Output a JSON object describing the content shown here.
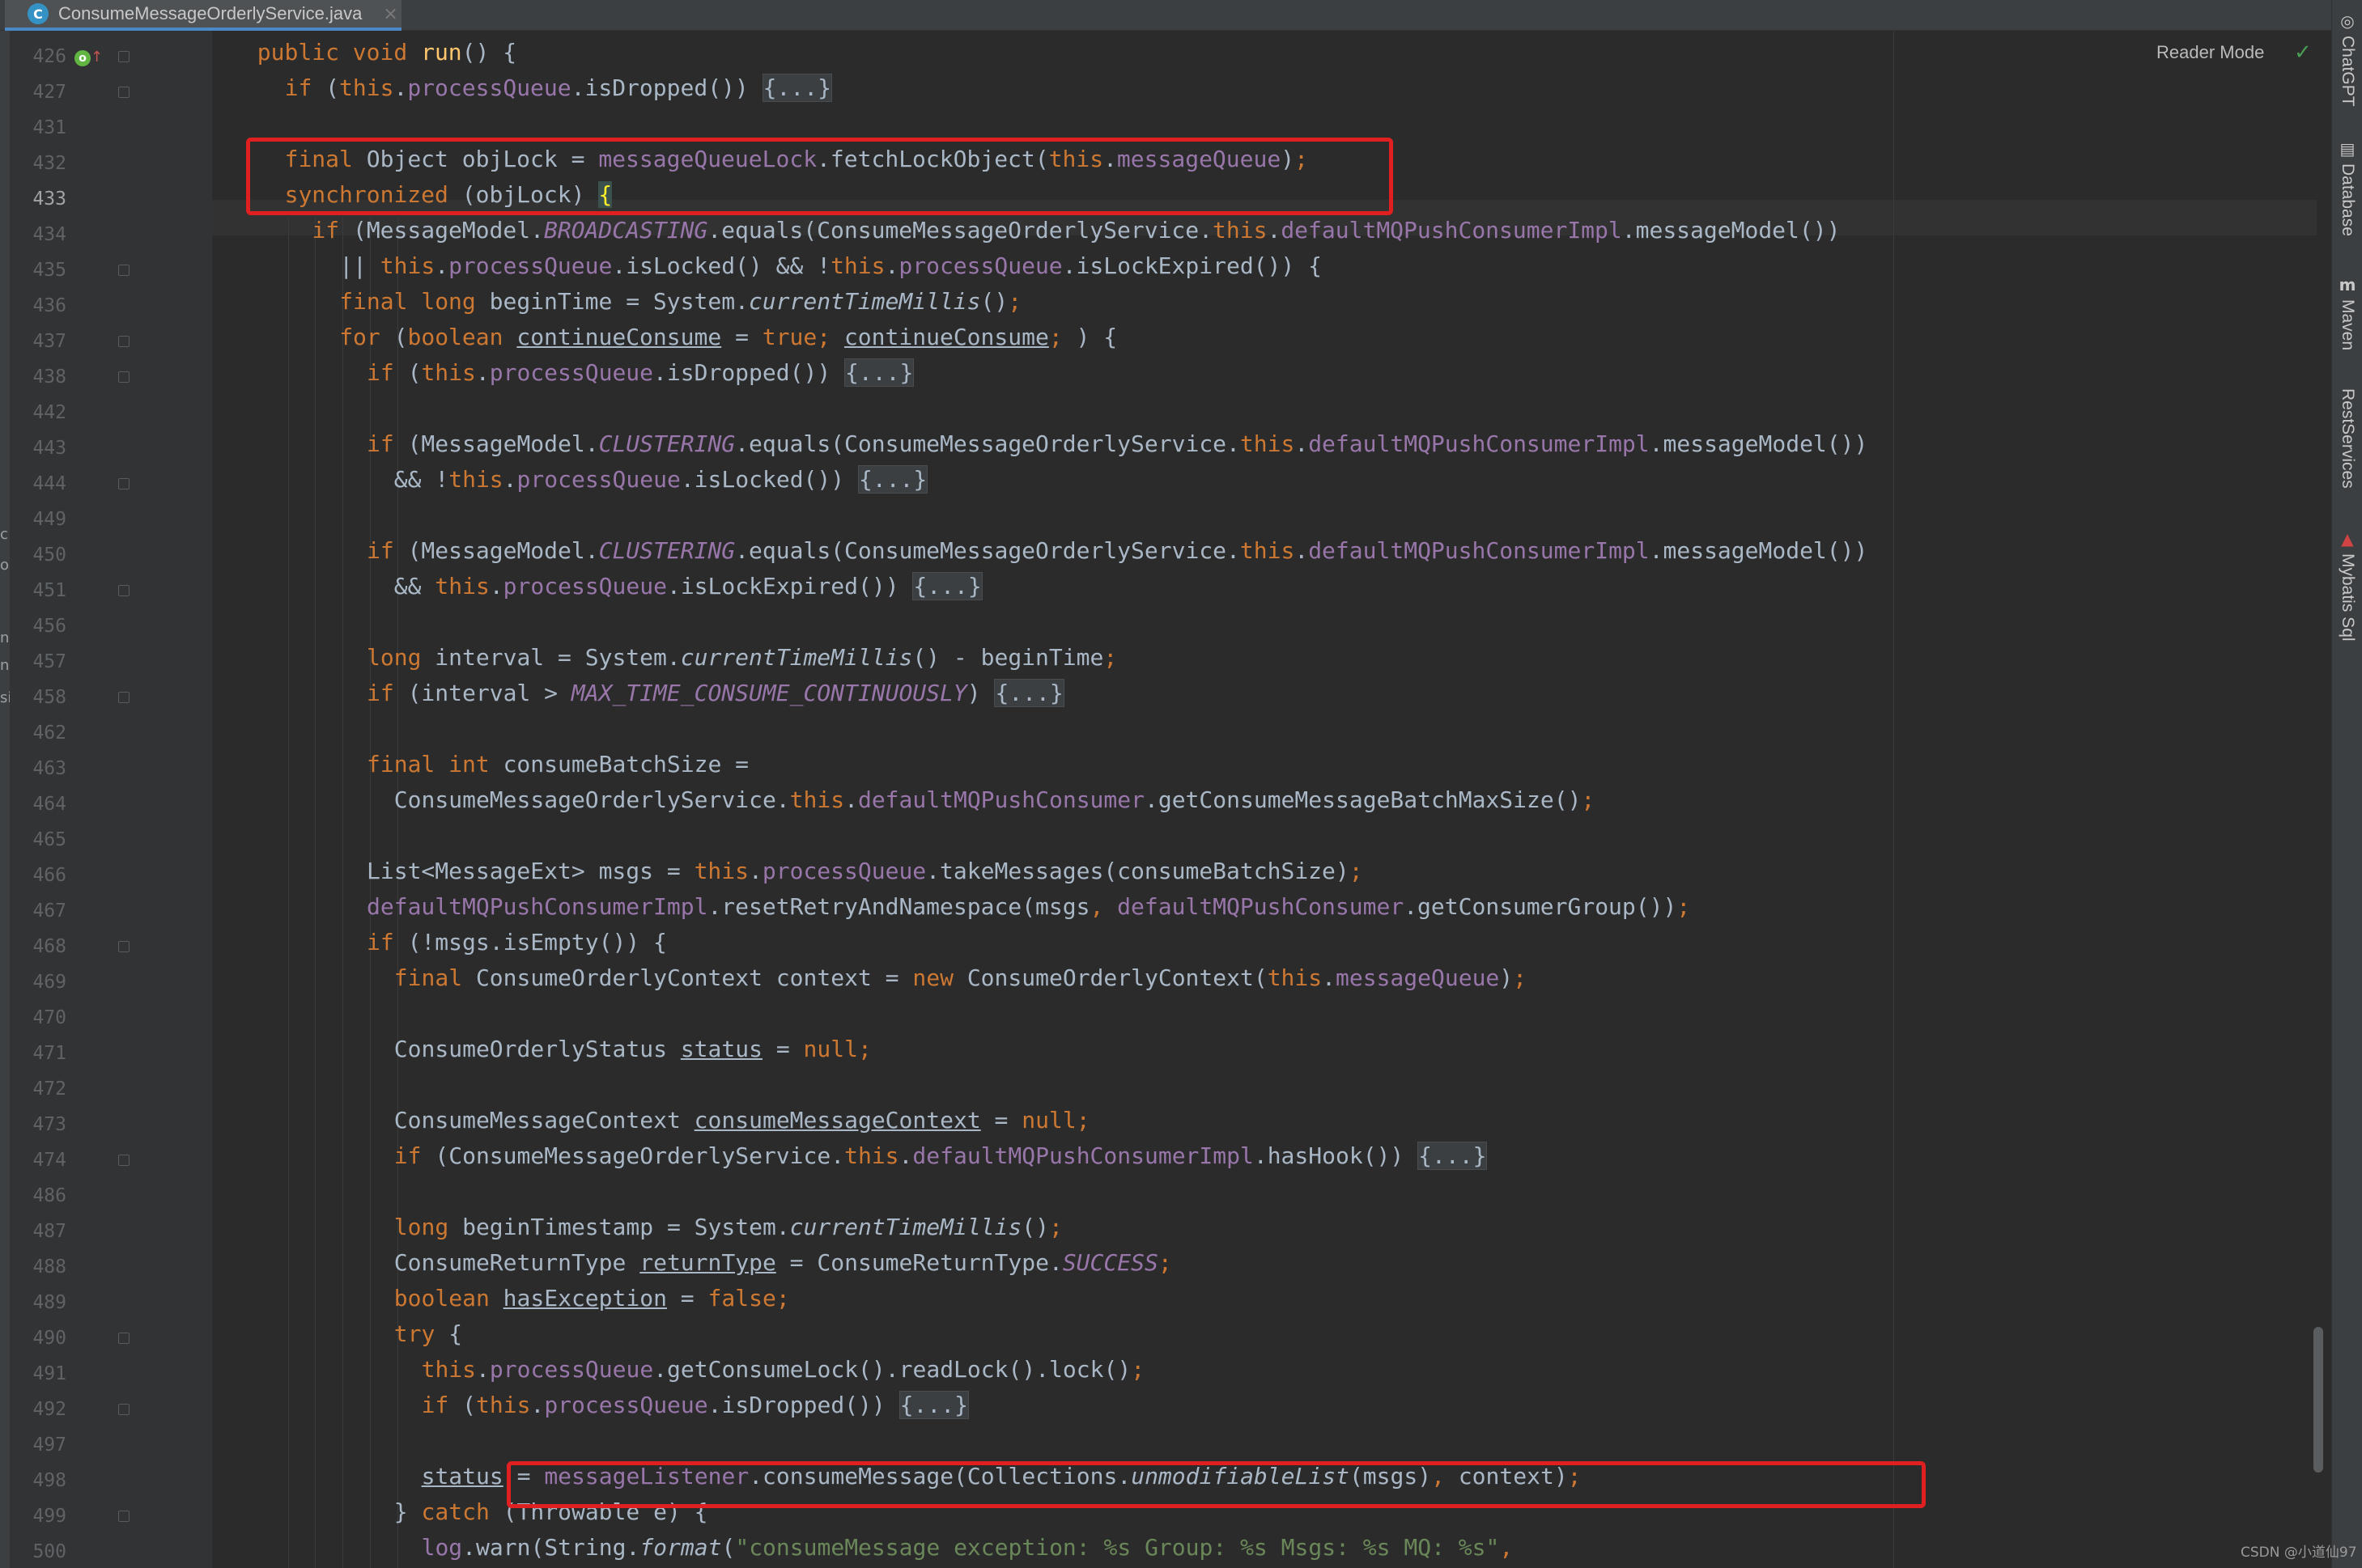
{
  "tab": {
    "icon": "C",
    "filename": "ConsumeMessageOrderlyService.java",
    "close": "×"
  },
  "editor": {
    "reader_mode": "Reader Mode",
    "check_icon": "✓"
  },
  "gutter": {
    "current_line": "433",
    "line_numbers": [
      "426",
      "427",
      "431",
      "432",
      "433",
      "434",
      "435",
      "436",
      "437",
      "438",
      "442",
      "443",
      "444",
      "449",
      "450",
      "451",
      "456",
      "457",
      "458",
      "462",
      "463",
      "464",
      "465",
      "466",
      "467",
      "468",
      "469",
      "470",
      "471",
      "472",
      "473",
      "474",
      "486",
      "487",
      "488",
      "489",
      "490",
      "491",
      "492",
      "497",
      "498",
      "499",
      "500"
    ],
    "override_badge": "o",
    "override_arrow": "↑"
  },
  "left_partial": [
    "c",
    "o",
    "n",
    "n",
    "si"
  ],
  "code": [
    [
      [
        "kw",
        "public void "
      ],
      [
        "mtd",
        "run"
      ],
      [
        "",
        "() {"
      ]
    ],
    [
      [
        "kw",
        "if "
      ],
      [
        "",
        "("
      ],
      [
        "kw",
        "this"
      ],
      [
        "",
        "."
      ],
      [
        "fld",
        "processQueue"
      ],
      [
        "",
        ".isDropped()) "
      ],
      [
        "fold",
        "{...}"
      ]
    ],
    [],
    [
      [
        "kw",
        "final "
      ],
      [
        "",
        "Object objLock = "
      ],
      [
        "fld",
        "messageQueueLock"
      ],
      [
        "",
        ".fetchLockObject("
      ],
      [
        "kw",
        "this"
      ],
      [
        "",
        "."
      ],
      [
        "fld",
        "messageQueue"
      ],
      [
        "",
        ")"
      ],
      [
        "kw",
        ";"
      ]
    ],
    [
      [
        "kw",
        "synchronized "
      ],
      [
        "",
        "(objLock) "
      ],
      [
        "bm",
        "{"
      ]
    ],
    [
      [
        "kw",
        "if "
      ],
      [
        "",
        "(MessageModel."
      ],
      [
        "st",
        "BROADCASTING"
      ],
      [
        "",
        ".equals(ConsumeMessageOrderlyService."
      ],
      [
        "kw",
        "this"
      ],
      [
        "",
        "."
      ],
      [
        "fld",
        "defaultMQPushConsumerImpl"
      ],
      [
        "",
        ".messageModel())"
      ]
    ],
    [
      [
        "",
        "|| "
      ],
      [
        "kw",
        "this"
      ],
      [
        "",
        "."
      ],
      [
        "fld",
        "processQueue"
      ],
      [
        "",
        ".isLocked() && !"
      ],
      [
        "kw",
        "this"
      ],
      [
        "",
        "."
      ],
      [
        "fld",
        "processQueue"
      ],
      [
        "",
        ".isLockExpired()) {"
      ]
    ],
    [
      [
        "kw",
        "final long "
      ],
      [
        "",
        "beginTime = System."
      ],
      [
        "ital",
        "currentTimeMillis"
      ],
      [
        "",
        "()"
      ],
      [
        "kw",
        ";"
      ]
    ],
    [
      [
        "kw",
        "for "
      ],
      [
        "",
        "("
      ],
      [
        "kw",
        "boolean "
      ],
      [
        "ul",
        "continueConsume"
      ],
      [
        "",
        " = "
      ],
      [
        "kw",
        "true; "
      ],
      [
        "ul",
        "continueConsume"
      ],
      [
        "kw",
        "; "
      ],
      [
        "",
        ") {"
      ]
    ],
    [
      [
        "kw",
        "if "
      ],
      [
        "",
        "("
      ],
      [
        "kw",
        "this"
      ],
      [
        "",
        "."
      ],
      [
        "fld",
        "processQueue"
      ],
      [
        "",
        ".isDropped()) "
      ],
      [
        "fold",
        "{...}"
      ]
    ],
    [],
    [
      [
        "kw",
        "if "
      ],
      [
        "",
        "(MessageModel."
      ],
      [
        "st",
        "CLUSTERING"
      ],
      [
        "",
        ".equals(ConsumeMessageOrderlyService."
      ],
      [
        "kw",
        "this"
      ],
      [
        "",
        "."
      ],
      [
        "fld",
        "defaultMQPushConsumerImpl"
      ],
      [
        "",
        ".messageModel())"
      ]
    ],
    [
      [
        "",
        "&& !"
      ],
      [
        "kw",
        "this"
      ],
      [
        "",
        "."
      ],
      [
        "fld",
        "processQueue"
      ],
      [
        "",
        ".isLocked()) "
      ],
      [
        "fold",
        "{...}"
      ]
    ],
    [],
    [
      [
        "kw",
        "if "
      ],
      [
        "",
        "(MessageModel."
      ],
      [
        "st",
        "CLUSTERING"
      ],
      [
        "",
        ".equals(ConsumeMessageOrderlyService."
      ],
      [
        "kw",
        "this"
      ],
      [
        "",
        "."
      ],
      [
        "fld",
        "defaultMQPushConsumerImpl"
      ],
      [
        "",
        ".messageModel())"
      ]
    ],
    [
      [
        "",
        "&& "
      ],
      [
        "kw",
        "this"
      ],
      [
        "",
        "."
      ],
      [
        "fld",
        "processQueue"
      ],
      [
        "",
        ".isLockExpired()) "
      ],
      [
        "fold",
        "{...}"
      ]
    ],
    [],
    [
      [
        "kw",
        "long "
      ],
      [
        "",
        "interval = System."
      ],
      [
        "ital",
        "currentTimeMillis"
      ],
      [
        "",
        "() - beginTime"
      ],
      [
        "kw",
        ";"
      ]
    ],
    [
      [
        "kw",
        "if "
      ],
      [
        "",
        "(interval > "
      ],
      [
        "st",
        "MAX_TIME_CONSUME_CONTINUOUSLY"
      ],
      [
        "",
        ") "
      ],
      [
        "fold",
        "{...}"
      ]
    ],
    [],
    [
      [
        "kw",
        "final int "
      ],
      [
        "",
        "consumeBatchSize ="
      ]
    ],
    [
      [
        "",
        "ConsumeMessageOrderlyService."
      ],
      [
        "kw",
        "this"
      ],
      [
        "",
        "."
      ],
      [
        "fld",
        "defaultMQPushConsumer"
      ],
      [
        "",
        ".getConsumeMessageBatchMaxSize()"
      ],
      [
        "kw",
        ";"
      ]
    ],
    [],
    [
      [
        "",
        "List<MessageExt> msgs = "
      ],
      [
        "kw",
        "this"
      ],
      [
        "",
        "."
      ],
      [
        "fld",
        "processQueue"
      ],
      [
        "",
        ".takeMessages(consumeBatchSize)"
      ],
      [
        "kw",
        ";"
      ]
    ],
    [
      [
        "fld",
        "defaultMQPushConsumerImpl"
      ],
      [
        "",
        ".resetRetryAndNamespace(msgs"
      ],
      [
        "kw",
        ", "
      ],
      [
        "fld",
        "defaultMQPushConsumer"
      ],
      [
        "",
        ".getConsumerGroup())"
      ],
      [
        "kw",
        ";"
      ]
    ],
    [
      [
        "kw",
        "if "
      ],
      [
        "",
        "(!msgs.isEmpty()) {"
      ]
    ],
    [
      [
        "kw",
        "final "
      ],
      [
        "",
        "ConsumeOrderlyContext context = "
      ],
      [
        "kw",
        "new "
      ],
      [
        "",
        "ConsumeOrderlyContext("
      ],
      [
        "kw",
        "this"
      ],
      [
        "",
        "."
      ],
      [
        "fld",
        "messageQueue"
      ],
      [
        "",
        ")"
      ],
      [
        "kw",
        ";"
      ]
    ],
    [],
    [
      [
        "",
        "ConsumeOrderlyStatus "
      ],
      [
        "ul",
        "status"
      ],
      [
        "",
        " = "
      ],
      [
        "kw",
        "null;"
      ]
    ],
    [],
    [
      [
        "",
        "ConsumeMessageContext "
      ],
      [
        "ul",
        "consumeMessageContext"
      ],
      [
        "",
        " = "
      ],
      [
        "kw",
        "null;"
      ]
    ],
    [
      [
        "kw",
        "if "
      ],
      [
        "",
        "(ConsumeMessageOrderlyService."
      ],
      [
        "kw",
        "this"
      ],
      [
        "",
        "."
      ],
      [
        "fld",
        "defaultMQPushConsumerImpl"
      ],
      [
        "",
        ".hasHook()) "
      ],
      [
        "fold",
        "{...}"
      ]
    ],
    [],
    [
      [
        "kw",
        "long "
      ],
      [
        "",
        "beginTimestamp = System."
      ],
      [
        "ital",
        "currentTimeMillis"
      ],
      [
        "",
        "()"
      ],
      [
        "kw",
        ";"
      ]
    ],
    [
      [
        "",
        "ConsumeReturnType "
      ],
      [
        "ul",
        "returnType"
      ],
      [
        "",
        " = ConsumeReturnType."
      ],
      [
        "st",
        "SUCCESS"
      ],
      [
        "kw",
        ";"
      ]
    ],
    [
      [
        "kw",
        "boolean "
      ],
      [
        "ul",
        "hasException"
      ],
      [
        "",
        " = "
      ],
      [
        "kw",
        "false;"
      ]
    ],
    [
      [
        "kw",
        "try "
      ],
      [
        "",
        "{"
      ]
    ],
    [
      [
        "kw",
        "this"
      ],
      [
        "",
        "."
      ],
      [
        "fld",
        "processQueue"
      ],
      [
        "",
        ".getConsumeLock().readLock().lock()"
      ],
      [
        "kw",
        ";"
      ]
    ],
    [
      [
        "kw",
        "if "
      ],
      [
        "",
        "("
      ],
      [
        "kw",
        "this"
      ],
      [
        "",
        "."
      ],
      [
        "fld",
        "processQueue"
      ],
      [
        "",
        ".isDropped()) "
      ],
      [
        "fold",
        "{...}"
      ]
    ],
    [],
    [
      [
        "ul",
        "status"
      ],
      [
        "",
        " = "
      ],
      [
        "fld",
        "messageListener"
      ],
      [
        "",
        ".consumeMessage(Collections."
      ],
      [
        "ital",
        "unmodifiableList"
      ],
      [
        "",
        "(msgs)"
      ],
      [
        "kw",
        ", "
      ],
      [
        "",
        "context)"
      ],
      [
        "kw",
        ";"
      ]
    ],
    [
      [
        "",
        "} "
      ],
      [
        "kw",
        "catch "
      ],
      [
        "",
        "(Throwable e) {"
      ]
    ],
    [
      [
        "fld",
        "log"
      ],
      [
        "",
        ".warn(String."
      ],
      [
        "ital",
        "format"
      ],
      [
        "",
        "("
      ],
      [
        "str",
        "\"consumeMessage exception: %s Group: %s Msgs: %s MQ: %s\""
      ],
      [
        "kw",
        ","
      ]
    ]
  ],
  "right_tools": [
    {
      "icon": "chatgpt-icon",
      "glyph": "◎",
      "label": "ChatGPT"
    },
    {
      "icon": "database-icon",
      "glyph": "▤",
      "label": "Database"
    },
    {
      "icon": "maven-icon",
      "glyph": "m",
      "label": "Maven"
    },
    {
      "icon": "rest-services-icon",
      "glyph": "",
      "label": "RestServices"
    },
    {
      "icon": "mybatis-icon",
      "glyph": "▲",
      "label": "Mybatis Sql"
    }
  ],
  "watermark": "CSDN @小道仙97",
  "colors": {
    "background": "#2b2b2b",
    "keyword": "#cc7832",
    "field": "#9876aa",
    "method": "#ffc66d",
    "string": "#6a8759",
    "highlight_box": "#e02020"
  }
}
